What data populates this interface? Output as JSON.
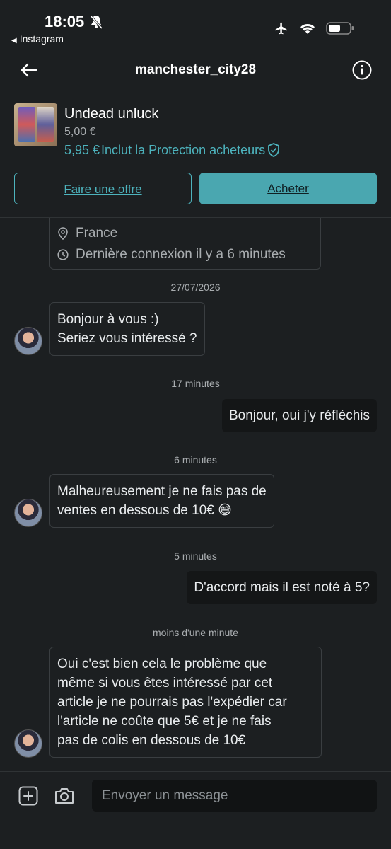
{
  "status_bar": {
    "time": "18:05",
    "back_app": "Instagram"
  },
  "header": {
    "title": "manchester_city28"
  },
  "product": {
    "title": "Undead unluck",
    "price": "5,00 €",
    "protection_price": "5,95 €",
    "protection_text": "Inclut la Protection acheteurs"
  },
  "actions": {
    "offer": "Faire une offre",
    "buy": "Acheter"
  },
  "profile_card": {
    "location": "France",
    "last_seen": "Dernière connexion il y a 6 minutes"
  },
  "messages": [
    {
      "date": "27/07/2026"
    },
    {
      "lines": [
        "Bonjour à vous :)",
        "Seriez vous intéressé ?"
      ]
    },
    {
      "date": "17 minutes"
    },
    {
      "text": "Bonjour, oui j'y réfléchis"
    },
    {
      "date": "6 minutes"
    },
    {
      "lines": [
        "Malheureusement je ne fais pas de",
        "ventes en dessous de 10€ 😅"
      ]
    },
    {
      "date": "5 minutes"
    },
    {
      "text": "D'accord mais il est noté à 5?"
    },
    {
      "date": "moins d'une minute"
    },
    {
      "lines": [
        "Oui c'est bien cela le problème que",
        "même si vous êtes intéressé par cet",
        "article je ne pourrais pas l'expédier car",
        "l'article ne coûte que 5€ et je ne fais",
        "pas de colis en dessous de 10€"
      ]
    }
  ],
  "composer": {
    "placeholder": "Envoyer un message"
  },
  "colors": {
    "accent": "#4db3bd",
    "background": "#1c1f21"
  }
}
